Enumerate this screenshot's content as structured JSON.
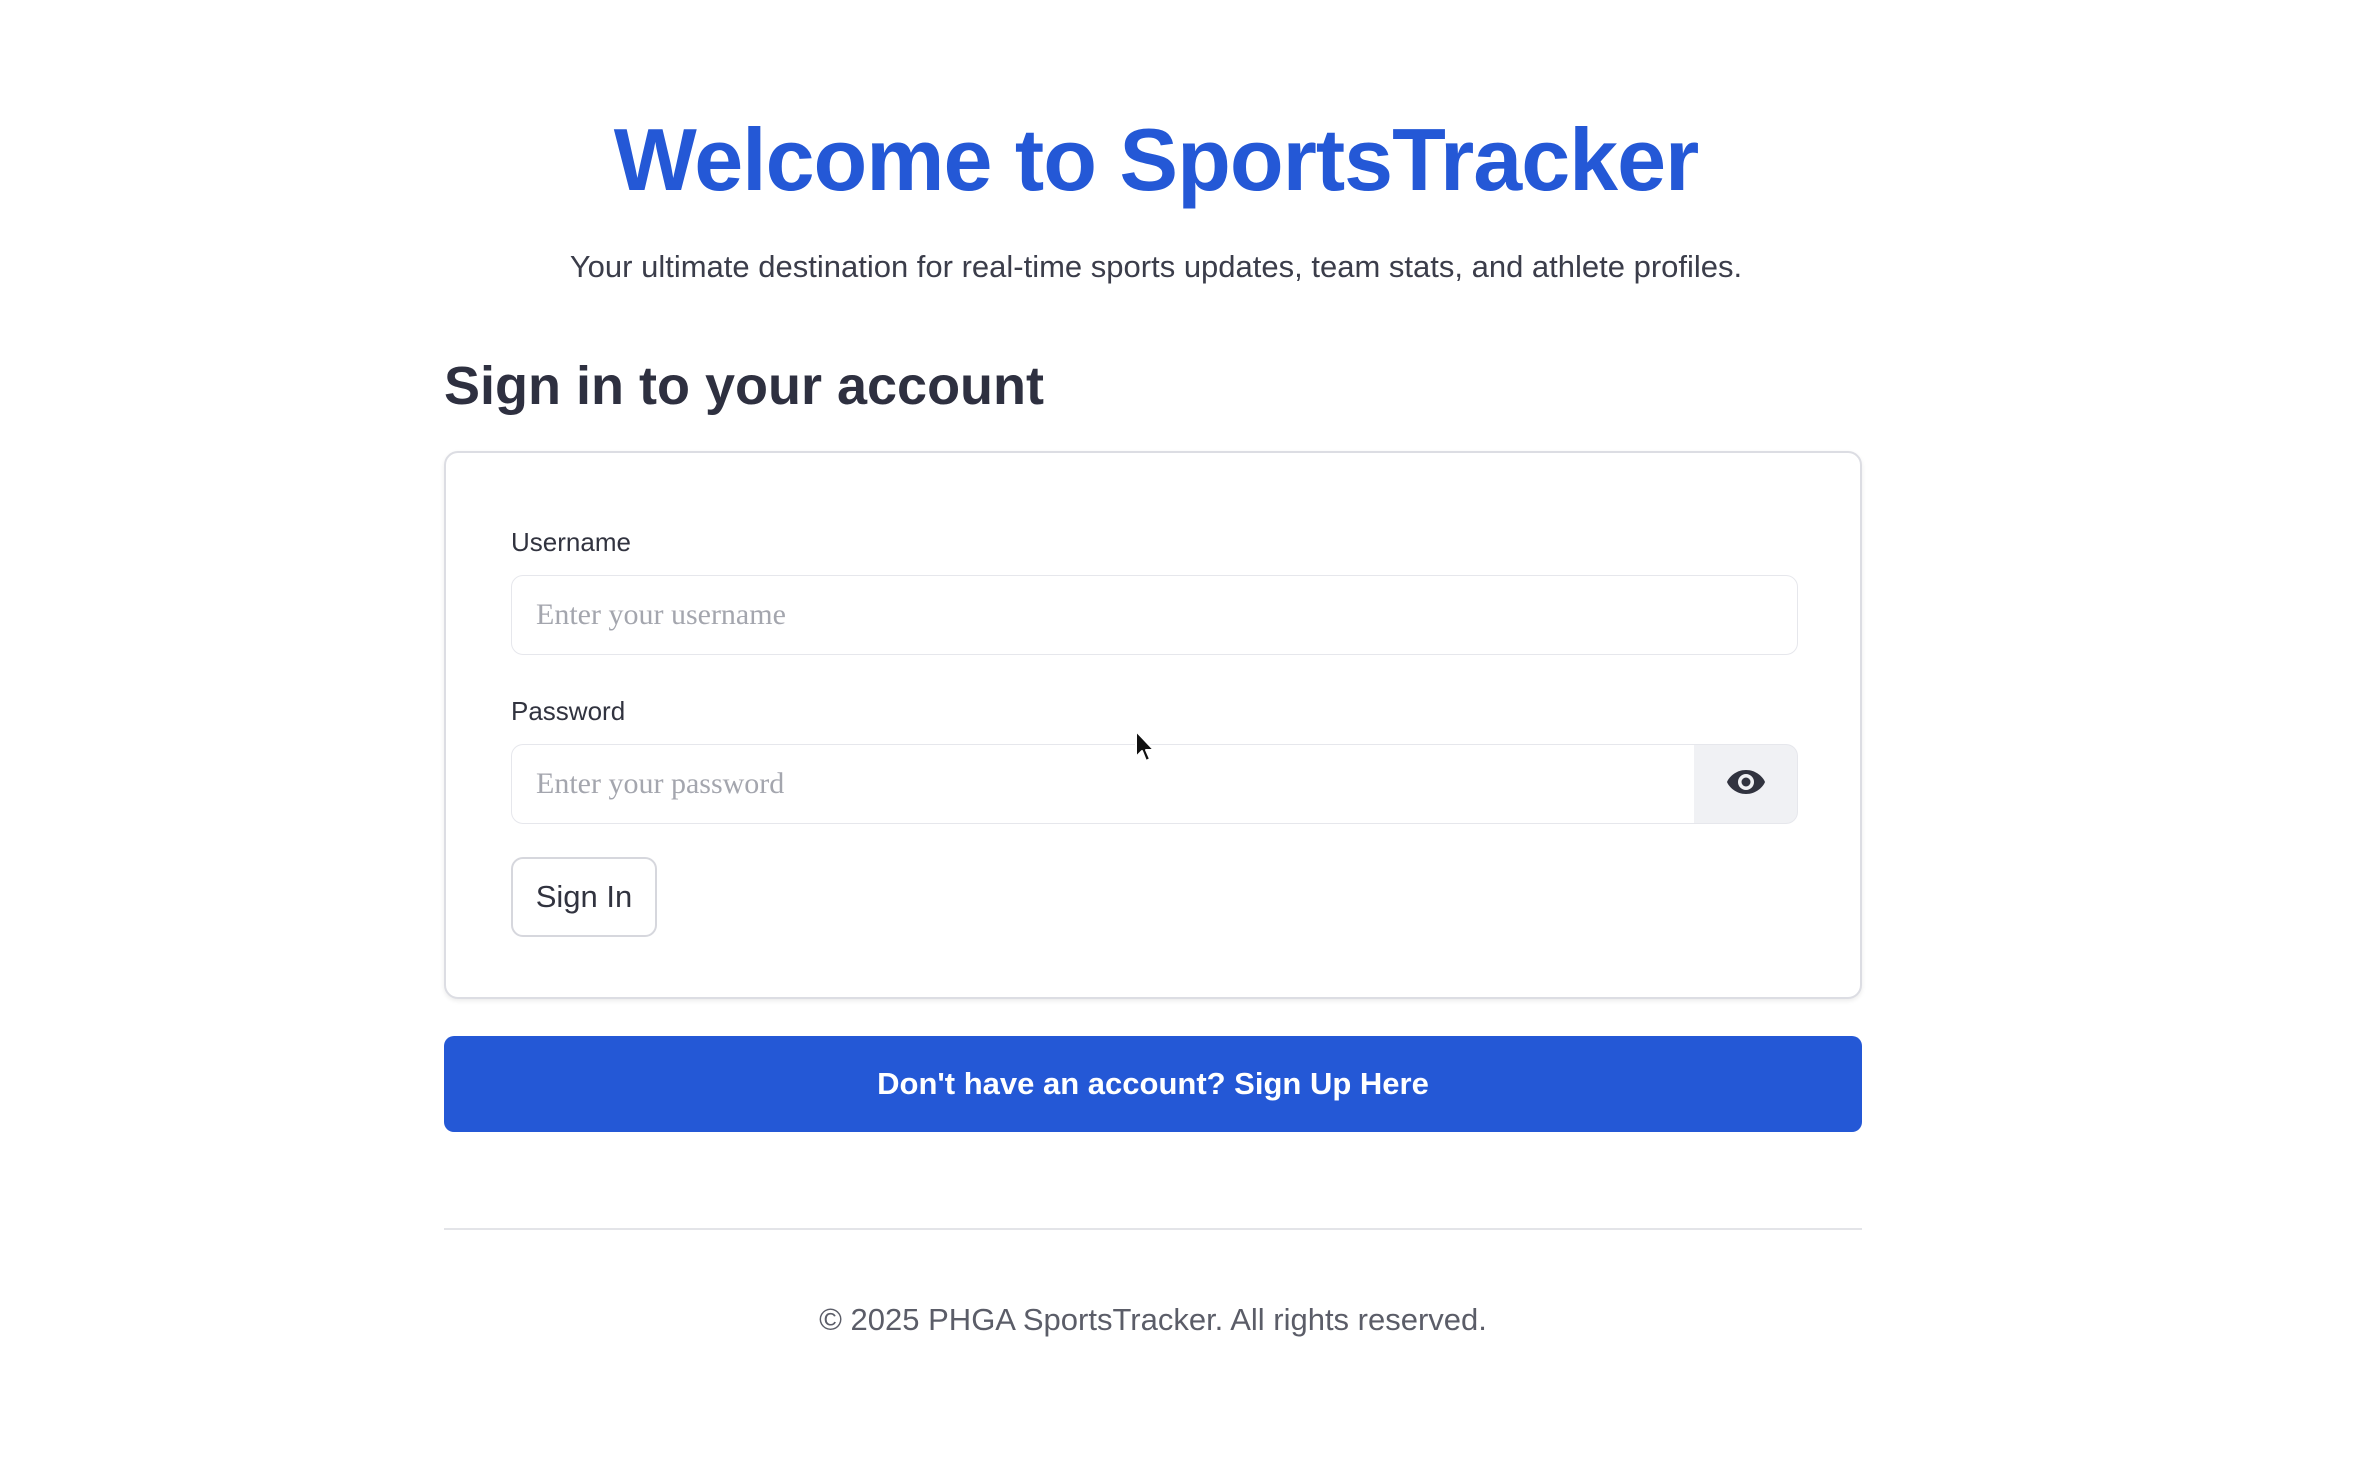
{
  "hero": {
    "title": "Welcome to SportsTracker",
    "subtitle": "Your ultimate destination for real-time sports updates, team stats, and athlete profiles."
  },
  "signin": {
    "heading": "Sign in to your account",
    "username_label": "Username",
    "username_placeholder": "Enter your username",
    "username_value": "",
    "password_label": "Password",
    "password_placeholder": "Enter your password",
    "password_value": "",
    "password_toggle_icon": "eye-icon",
    "submit_label": "Sign In"
  },
  "signup": {
    "label": "Don't have an account? Sign Up Here"
  },
  "footer": {
    "text": "© 2025 PHGA SportsTracker. All rights reserved."
  },
  "colors": {
    "brand": "#2458d6",
    "text": "#31333f",
    "muted": "#5b5d68",
    "placeholder": "#a4a6ae"
  }
}
